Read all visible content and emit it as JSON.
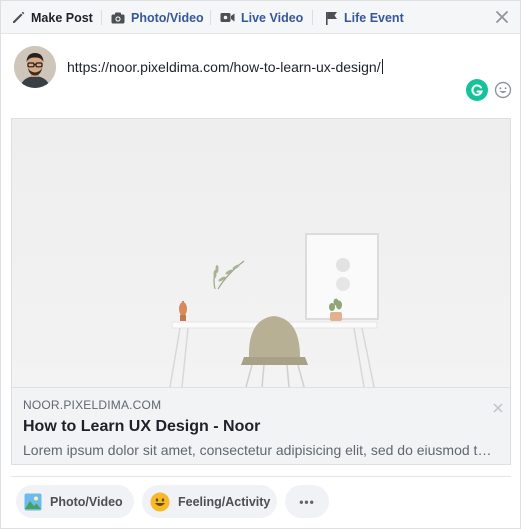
{
  "tabs": {
    "make_post": "Make Post",
    "photo_video": "Photo/Video",
    "live_video": "Live Video",
    "life_event": "Life Event"
  },
  "composer": {
    "text": "https://noor.pixeldima.com/how-to-learn-ux-design/"
  },
  "link_preview": {
    "domain": "NOOR.PIXELDIMA.COM",
    "title": "How to Learn UX Design - Noor",
    "description": "Lorem ipsum dolor sit amet, consectetur adipisicing elit, sed do eiusmod tempor incididunt ut labore"
  },
  "options": {
    "photo_video": "Photo/Video",
    "feeling_activity": "Feeling/Activity",
    "more": "•••"
  },
  "colors": {
    "accent": "#365899",
    "grammarly": "#15c39a",
    "pill_bg": "#f0f2f5",
    "meta_bg": "#f2f3f5"
  },
  "icons": [
    "pencil-icon",
    "camera-icon",
    "video-camera-icon",
    "flag-icon",
    "close-icon",
    "grammarly-icon",
    "emoji-icon",
    "photo-icon",
    "smiley-icon",
    "more-icon"
  ]
}
